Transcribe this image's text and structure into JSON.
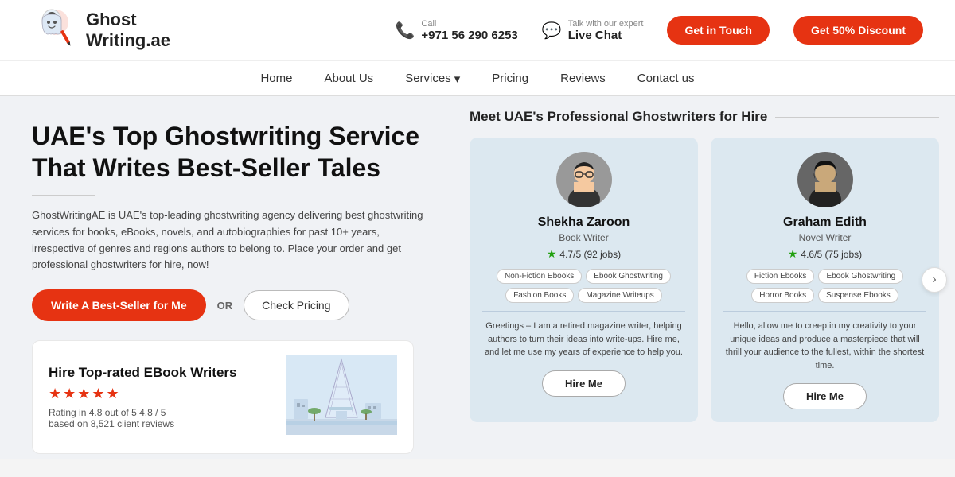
{
  "header": {
    "logo_line1": "Ghost",
    "logo_line2": "Writing.ae",
    "call_label": "Call",
    "phone": "+971 56 290 6253",
    "chat_label": "Talk with our expert",
    "chat_value": "Live Chat",
    "btn_contact": "Get in Touch",
    "btn_discount": "Get 50% Discount"
  },
  "nav": {
    "items": [
      {
        "label": "Home"
      },
      {
        "label": "About Us"
      },
      {
        "label": "Services"
      },
      {
        "label": "Pricing"
      },
      {
        "label": "Reviews"
      },
      {
        "label": "Contact us"
      }
    ]
  },
  "hero": {
    "title_line1": "UAE's Top Ghostwriting Service",
    "title_line2": "That Writes Best-Seller Tales",
    "description": "GhostWritingAE is UAE's top-leading ghostwriting agency delivering best ghostwriting services for books, eBooks, novels, and autobiographies for past 10+ years, irrespective of genres and regions authors to belong to. Place your order and get professional ghostwriters for hire, now!",
    "cta_primary": "Write A Best-Seller for Me",
    "or_text": "OR",
    "cta_secondary": "Check Pricing"
  },
  "hire_card": {
    "title": "Hire Top-rated EBook Writers",
    "stars": "★★★★★",
    "rating_text": "Rating in 4.8 out of 5 4.8 / 5",
    "reviews_text": "based on 8,521 client reviews"
  },
  "writers_section": {
    "title": "Meet UAE's Professional Ghostwriters for Hire",
    "writers": [
      {
        "name": "Shekha Zaroon",
        "role": "Book Writer",
        "rating": "4.7/5 (92 jobs)",
        "tags": [
          "Non-Fiction Ebooks",
          "Ebook Ghostwriting",
          "Fashion Books",
          "Magazine Writeups"
        ],
        "bio": "Greetings – I am a retired magazine writer, helping authors to turn their ideas into write-ups. Hire me, and let me use my years of experience to help you.",
        "btn": "Hire Me",
        "avatar_emoji": "👩"
      },
      {
        "name": "Graham Edith",
        "role": "Novel Writer",
        "rating": "4.6/5 (75 jobs)",
        "tags": [
          "Fiction Ebooks",
          "Ebook Ghostwriting",
          "Horror Books",
          "Suspense Ebooks"
        ],
        "bio": "Hello, allow me to creep in my creativity to your unique ideas and produce a masterpiece that will thrill your audience to the fullest, within the shortest time.",
        "btn": "Hire Me",
        "avatar_emoji": "👩‍🦱"
      }
    ]
  }
}
